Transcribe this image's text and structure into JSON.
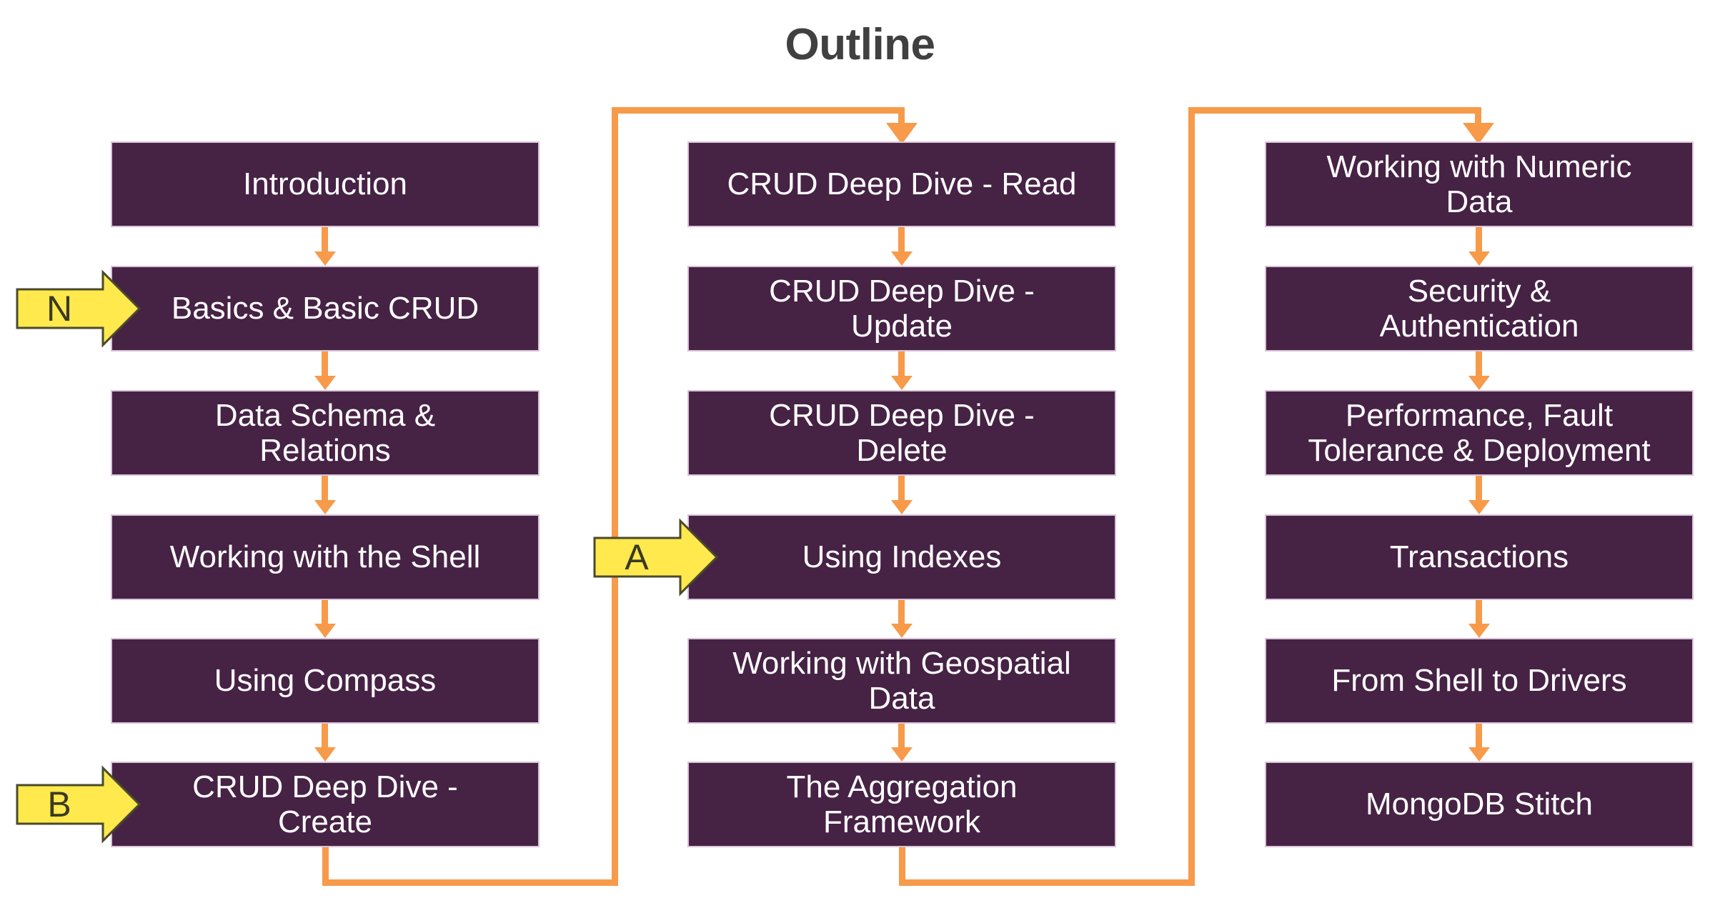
{
  "page": {
    "title": "Outline",
    "background": "#ffffff",
    "title_color": "#404040"
  },
  "theme": {
    "node_fill": "#462245",
    "node_border": "#d9c3d8",
    "node_text": "#ffffff",
    "connector": "#f79a4a",
    "marker_fill": "#ffe94d",
    "marker_stroke": "#4a4a2a",
    "marker_text": "#3a3a22"
  },
  "columns": [
    {
      "name": "column-1",
      "nodes": [
        {
          "label": "Introduction"
        },
        {
          "label": "Basics & Basic CRUD"
        },
        {
          "label": "Data Schema &\nRelations"
        },
        {
          "label": "Working with the Shell"
        },
        {
          "label": "Using Compass"
        },
        {
          "label": "CRUD Deep Dive -\nCreate"
        }
      ]
    },
    {
      "name": "column-2",
      "nodes": [
        {
          "label": "CRUD Deep Dive - Read"
        },
        {
          "label": "CRUD Deep Dive -\nUpdate"
        },
        {
          "label": "CRUD Deep Dive -\nDelete"
        },
        {
          "label": "Using Indexes"
        },
        {
          "label": "Working with Geospatial\nData"
        },
        {
          "label": "The Aggregation\nFramework"
        }
      ]
    },
    {
      "name": "column-3",
      "nodes": [
        {
          "label": "Working with Numeric\nData"
        },
        {
          "label": "Security &\nAuthentication"
        },
        {
          "label": "Performance, Fault\nTolerance & Deployment"
        },
        {
          "label": "Transactions"
        },
        {
          "label": "From Shell to Drivers"
        },
        {
          "label": "MongoDB Stitch"
        }
      ]
    }
  ],
  "markers": [
    {
      "name": "marker-n",
      "label": "N",
      "target": "Basics & Basic CRUD"
    },
    {
      "name": "marker-a",
      "label": "A",
      "target": "Using Indexes"
    },
    {
      "name": "marker-b",
      "label": "B",
      "target": "CRUD Deep Dive - Create"
    }
  ]
}
